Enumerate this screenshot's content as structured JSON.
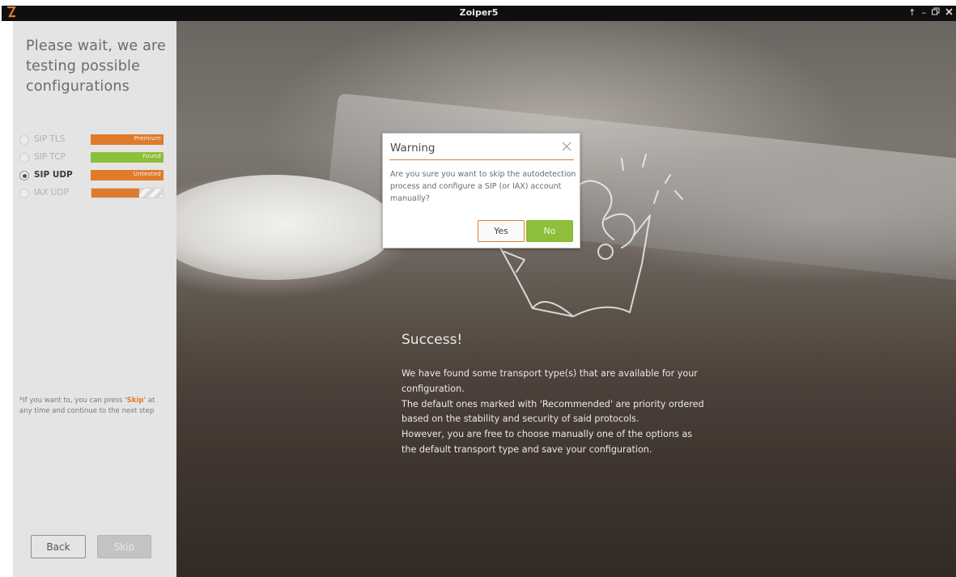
{
  "window": {
    "title": "Zoiper5",
    "controls": [
      "↑",
      "–",
      "🗗",
      "✕"
    ]
  },
  "sidebar": {
    "heading": "Please wait, we are testing possible configurations",
    "protocols": [
      {
        "label": "SIP TLS",
        "status": "Premium",
        "state_color": "#e07b2c",
        "selected": false,
        "active": false
      },
      {
        "label": "SIP TCP",
        "status": "Found",
        "state_color": "#8ebf3a",
        "selected": false,
        "active": false
      },
      {
        "label": "SIP UDP",
        "status": "Untested",
        "state_color": "#e07b2c",
        "selected": true,
        "active": true
      },
      {
        "label": "IAX UDP",
        "status": "",
        "state_color": "#e07b2c",
        "selected": false,
        "active": false,
        "progress": 0.67
      }
    ],
    "skip_note_prefix": "*If you want to, you can press ",
    "skip_note_keyword": "'Skip'",
    "skip_note_suffix": " at any time and continue to the next step",
    "back_label": "Back",
    "skip_label": "Skip"
  },
  "main": {
    "success_title": "Success!",
    "success_text": "We have found some transport type(s) that are available for your configuration.\nThe default ones marked with 'Recommended' are priority ordered based on the stability and security of said protocols.\nHowever, you are free to choose manually one of the options as the default  transport type and save your configuration."
  },
  "dialog": {
    "title": "Warning",
    "message": "Are you sure you want to skip the autodetection process and configure a SIP (or IAX) account manually?",
    "yes_label": "Yes",
    "no_label": "No"
  },
  "colors": {
    "accent_orange": "#e07b2c",
    "accent_green": "#8ebf3a",
    "sidebar_bg": "#e4e4e4"
  },
  "icons": {
    "app": "zoiper-logo-icon",
    "close": "close-icon"
  }
}
